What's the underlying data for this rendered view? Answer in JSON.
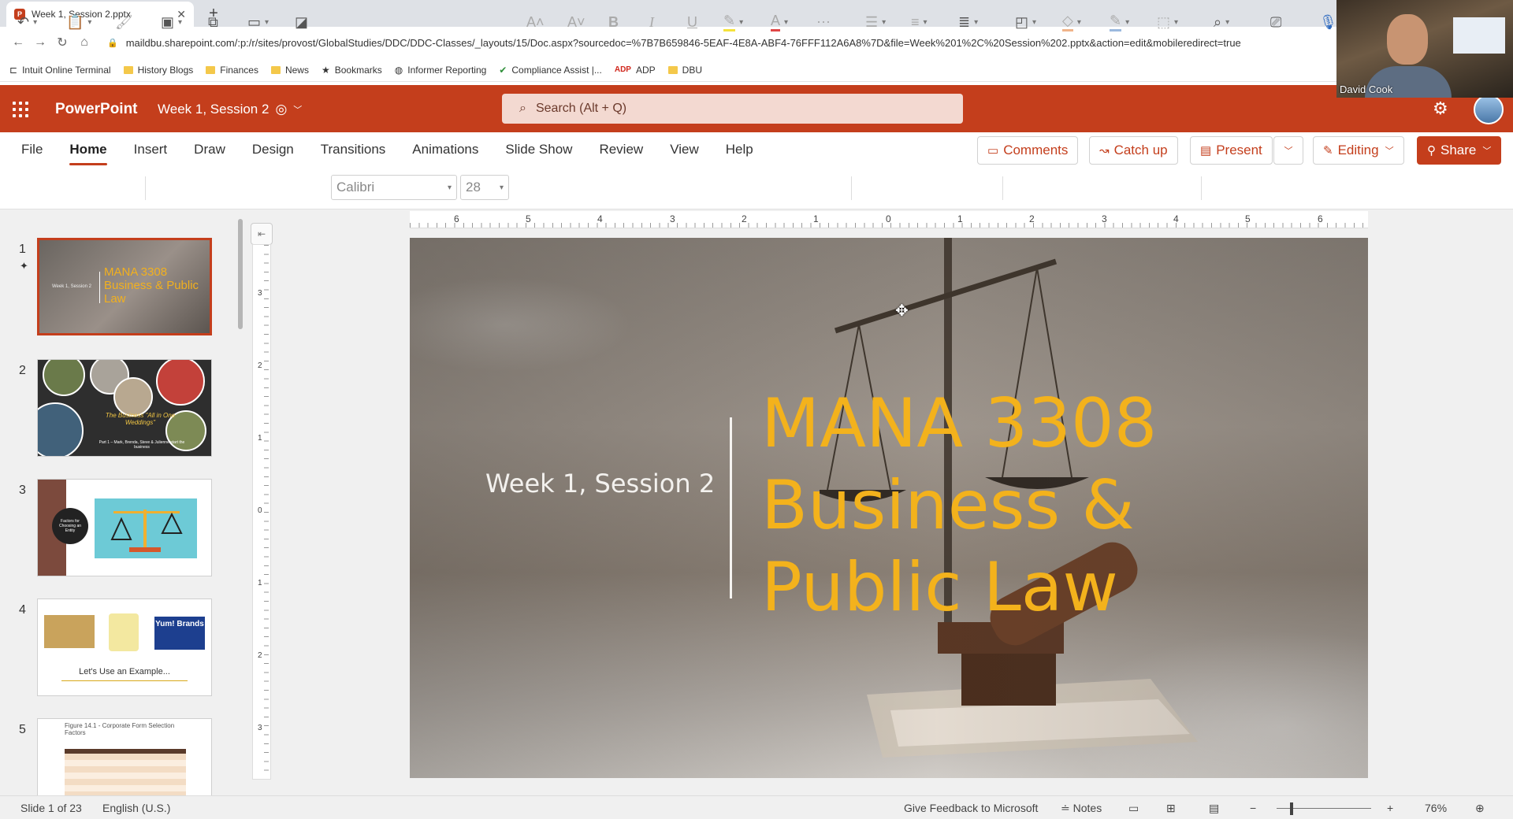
{
  "browser": {
    "tab_title": "Week 1, Session 2.pptx",
    "url": "maildbu.sharepoint.com/:p:/r/sites/provost/GlobalStudies/DDC/DDC-Classes/_layouts/15/Doc.aspx?sourcedoc=%7B7B659846-5EAF-4E8A-ABF4-76FFF112A6A8%7D&file=Week%201%2C%20Session%202.pptx&action=edit&mobileredirect=true",
    "bookmarks": [
      {
        "label": "Intuit Online Terminal",
        "icon": "intuit-icon"
      },
      {
        "label": "History Blogs",
        "icon": "folder-icon"
      },
      {
        "label": "Finances",
        "icon": "folder-icon"
      },
      {
        "label": "News",
        "icon": "folder-icon"
      },
      {
        "label": "Bookmarks",
        "icon": "star-icon"
      },
      {
        "label": "Informer Reporting",
        "icon": "globe-icon"
      },
      {
        "label": "Compliance Assist |...",
        "icon": "check-icon"
      },
      {
        "label": "ADP",
        "icon": "adp-icon"
      },
      {
        "label": "DBU",
        "icon": "folder-icon"
      }
    ]
  },
  "office": {
    "app_name": "PowerPoint",
    "doc_title": "Week 1, Session 2",
    "search_placeholder": "Search (Alt + Q)"
  },
  "ribbon": {
    "tabs": [
      "File",
      "Home",
      "Insert",
      "Draw",
      "Design",
      "Transitions",
      "Animations",
      "Slide Show",
      "Review",
      "View",
      "Help"
    ],
    "active_tab": "Home",
    "comments": "Comments",
    "catch_up": "Catch up",
    "present": "Present",
    "editing": "Editing",
    "share": "Share"
  },
  "toolbar": {
    "font_name": "Calibri",
    "font_size": "28"
  },
  "ruler": {
    "h_labels": [
      "6",
      "5",
      "4",
      "3",
      "2",
      "1",
      "0",
      "1",
      "2",
      "3",
      "4",
      "5",
      "6"
    ],
    "v_labels": [
      "3",
      "2",
      "1",
      "0",
      "1",
      "2",
      "3"
    ]
  },
  "thumbnails": {
    "numbers": [
      "1",
      "2",
      "3",
      "4",
      "5"
    ],
    "slide1_title": "MANA 3308 Business & Public Law",
    "slide2_caption": "The Business \"All in One Weddings\"",
    "slide2_sub": "Part 1 – Mark, Brenda, Steve & Julienne start the business",
    "slide3_circle": "Factors for Choosing an Entity",
    "slide4_brand": "Yum! Brands",
    "slide4_caption": "Let's Use an Example...",
    "slide5_caption": "Figure 14.1 - Corporate Form Selection Factors"
  },
  "slide": {
    "subtitle": "Week 1, Session 2",
    "title_line1": "MANA 3308",
    "title_line2": "Business &",
    "title_line3": "Public Law",
    "title_color": "#f3b21c"
  },
  "status": {
    "slide_count": "Slide 1 of 23",
    "language": "English (U.S.)",
    "feedback": "Give Feedback to Microsoft",
    "notes": "Notes",
    "zoom": "76%"
  },
  "video": {
    "participant": "David Cook"
  },
  "colors": {
    "brand": "#c43e1c",
    "accent_title": "#f3b21c"
  }
}
